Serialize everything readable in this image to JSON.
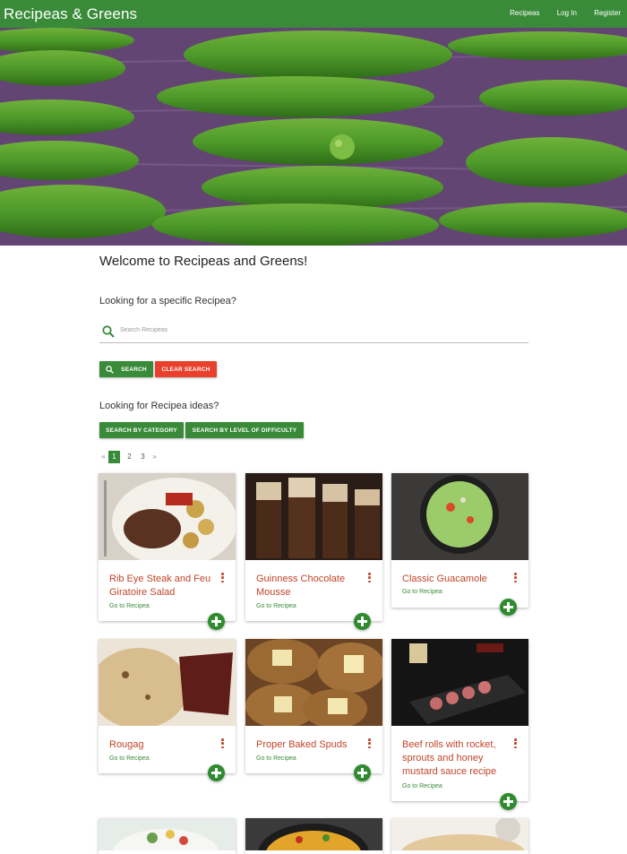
{
  "navbar": {
    "brand": "Recipeas & Greens",
    "links": [
      "Recipeas",
      "Log In",
      "Register"
    ]
  },
  "welcome": "Welcome to Recipeas and Greens!",
  "search_section": {
    "heading": "Looking for a specific Recipea?",
    "placeholder": "Search Recipeas",
    "search_button": "Search",
    "clear_button": "Clear Search"
  },
  "ideas_section": {
    "heading": "Looking for Recipea ideas?",
    "category_button": "Search by Category",
    "difficulty_button": "Search by Level of Difficulty"
  },
  "pagination": {
    "prev": "«",
    "pages": [
      "1",
      "2",
      "3"
    ],
    "active": "1",
    "next": "»"
  },
  "cards": [
    {
      "title": "Rib Eye Steak and Feu Giratoire Salad",
      "link": "Go to Recipea"
    },
    {
      "title": "Guinness Chocolate Mousse",
      "link": "Go to Recipea"
    },
    {
      "title": "Classic Guacamole",
      "link": "Go to Recipea"
    },
    {
      "title": "Rougag",
      "link": "Go to Recipea"
    },
    {
      "title": "Proper Baked Spuds",
      "link": "Go to Recipea"
    },
    {
      "title": "Beef rolls with rocket, sprouts and honey mustard sauce recipe",
      "link": "Go to Recipea"
    }
  ],
  "colors": {
    "primary": "#398b39",
    "danger": "#e8402d",
    "card_title": "#c0452a"
  }
}
